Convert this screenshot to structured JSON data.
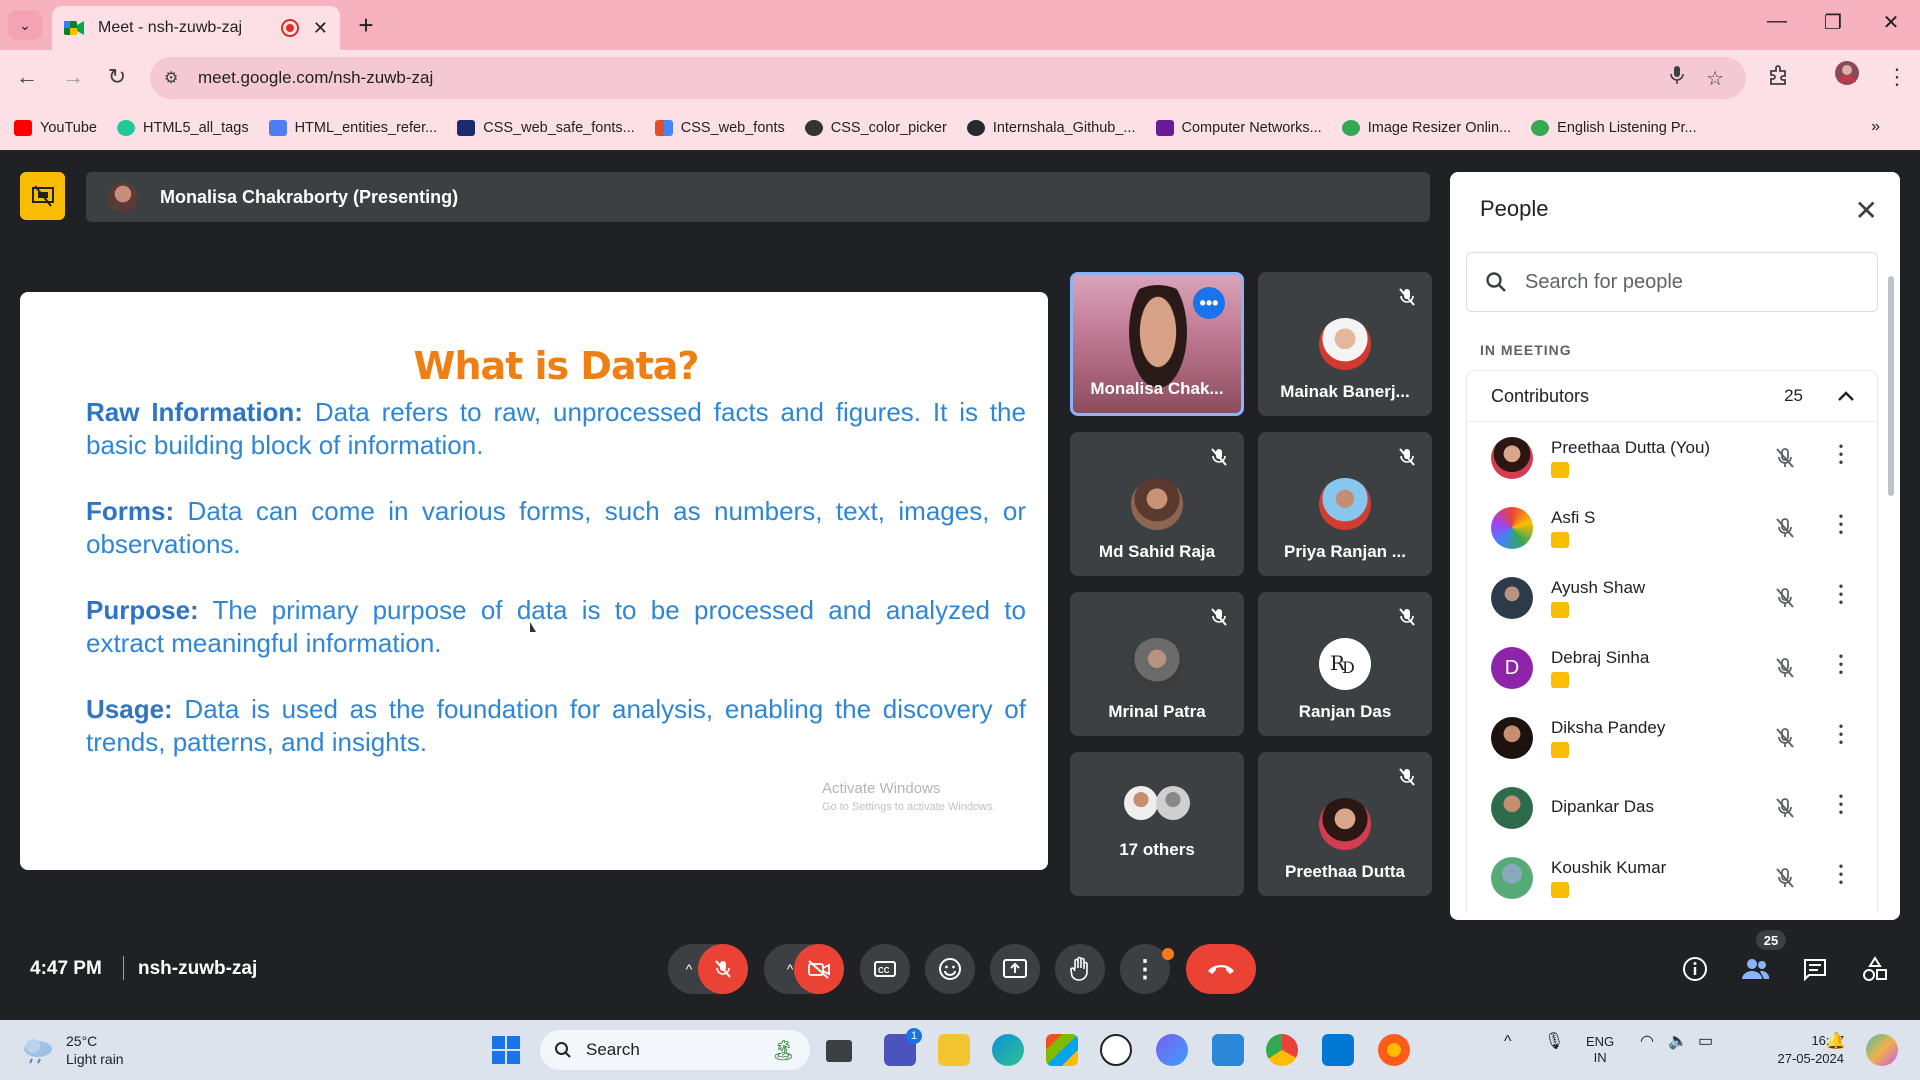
{
  "browser": {
    "tab_title": "Meet - nsh-zuwb-zaj",
    "url": "meet.google.com/nsh-zuwb-zaj",
    "bookmarks": [
      {
        "label": "YouTube",
        "color": "#ff0000"
      },
      {
        "label": "HTML5_all_tags",
        "color": "#20c997"
      },
      {
        "label": "HTML_entities_refer...",
        "color": "#4f7df3"
      },
      {
        "label": "CSS_web_safe_fonts...",
        "color": "#1b2a6b"
      },
      {
        "label": "CSS_web_fonts",
        "color": "#e34c26"
      },
      {
        "label": "CSS_color_picker",
        "color": "#333333"
      },
      {
        "label": "Internshala_Github_...",
        "color": "#24292e"
      },
      {
        "label": "Computer Networks...",
        "color": "#6a1b9a"
      },
      {
        "label": "Image Resizer Onlin...",
        "color": "#34a853"
      },
      {
        "label": "English Listening Pr...",
        "color": "#34a853"
      }
    ]
  },
  "meet": {
    "presenter_label": "Monalisa Chakraborty (Presenting)",
    "slide": {
      "title": "What is Data?",
      "items": [
        {
          "head": "Raw Information:",
          "text": " Data refers to raw, unprocessed facts and figures. It is the basic building block of information."
        },
        {
          "head": "Forms:",
          "text": " Data can come in various forms, such as numbers, text, images, or observations."
        },
        {
          "head": "Purpose:",
          "text": " The primary purpose of data is to be processed and analyzed to extract meaningful information."
        },
        {
          "head": "Usage:",
          "text": " Data is used as the foundation for analysis, enabling the discovery of trends, patterns, and insights."
        }
      ],
      "watermark_1": "Activate Windows",
      "watermark_2": "Go to Settings to activate Windows."
    },
    "tiles": [
      {
        "name": "Monalisa Chak..."
      },
      {
        "name": "Mainak Banerj..."
      },
      {
        "name": "Md Sahid Raja"
      },
      {
        "name": "Priya Ranjan ..."
      },
      {
        "name": "Mrinal Patra"
      },
      {
        "name": "Ranjan Das"
      },
      {
        "name": "17 others"
      },
      {
        "name": "Preethaa Dutta"
      }
    ],
    "time": "4:47 PM",
    "meeting_code": "nsh-zuwb-zaj",
    "people_count": "25"
  },
  "people_panel": {
    "title": "People",
    "search_placeholder": "Search for people",
    "section": "IN MEETING",
    "group_label": "Contributors",
    "group_count": "25",
    "participants": [
      {
        "name": "Preethaa Dutta (You)"
      },
      {
        "name": "Asfi S"
      },
      {
        "name": "Ayush Shaw"
      },
      {
        "name": "Debraj Sinha",
        "initial": "D"
      },
      {
        "name": "Diksha Pandey"
      },
      {
        "name": "Dipankar Das"
      },
      {
        "name": "Koushik Kumar"
      }
    ]
  },
  "taskbar": {
    "temp": "25°C",
    "weather": "Light rain",
    "search": "Search",
    "teams_badge": "1",
    "lang_1": "ENG",
    "lang_2": "IN",
    "time": "16:47",
    "date": "27-05-2024"
  }
}
